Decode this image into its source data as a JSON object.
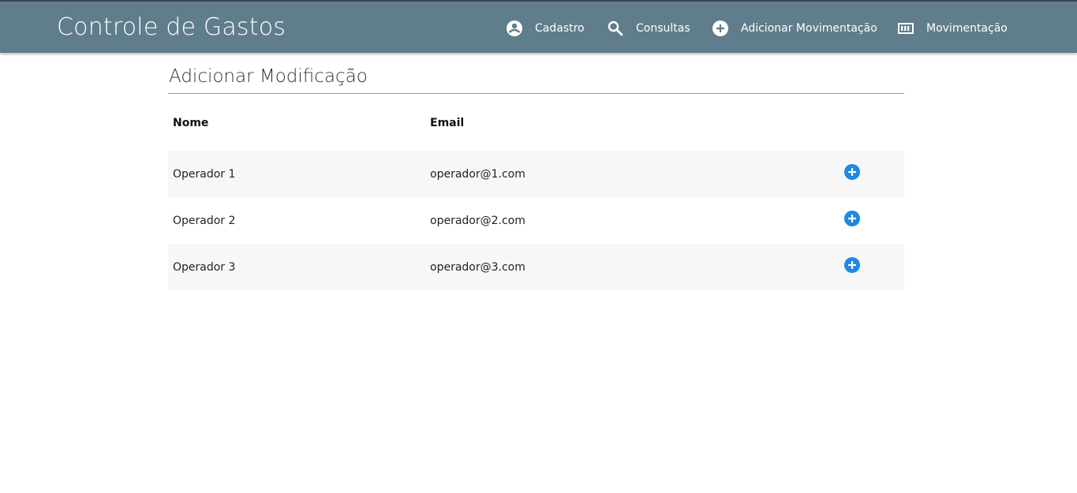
{
  "app": {
    "title": "Controle de Gastos"
  },
  "nav": {
    "cadastro": {
      "label": "Cadastro",
      "icon": "account-circle-icon"
    },
    "consultas": {
      "label": "Consultas",
      "icon": "search-icon"
    },
    "adicionar": {
      "label": "Adicionar Movimentação",
      "icon": "add-circle-icon"
    },
    "movimentacao": {
      "label": "Movimentação",
      "icon": "list-box-icon"
    }
  },
  "page": {
    "title": "Adicionar Modificação"
  },
  "table": {
    "headers": {
      "nome": "Nome",
      "email": "Email"
    },
    "rows": [
      {
        "nome": "Operador 1",
        "email": "operador@1.com"
      },
      {
        "nome": "Operador 2",
        "email": "operador@2.com"
      },
      {
        "nome": "Operador 3",
        "email": "operador@3.com"
      }
    ]
  },
  "colors": {
    "header_bg": "#607d8b",
    "accent": "#1e88e5",
    "row_stripe": "#f7f7f7"
  }
}
